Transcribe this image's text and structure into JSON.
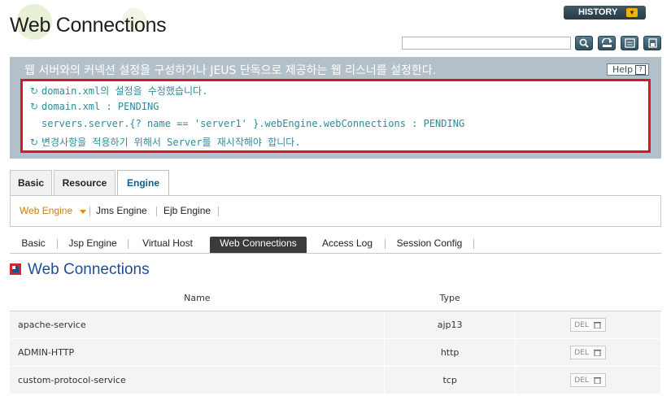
{
  "header": {
    "title": "Web Connections",
    "history_label": "HISTORY",
    "search_value": ""
  },
  "message": {
    "title": "웹 서버와의 커넥션 설정을 구성하거나 JEUS 단독으로 제공하는 웹 리스너를 설정한다.",
    "help_label": "Help",
    "lines": [
      "domain.xml의 설정을 수정했습니다.",
      "domain.xml : PENDING",
      "servers.server.{? name == 'server1' }.webEngine.webConnections : PENDING",
      "변경사항을 적용하기 위해서 Server를 재시작해야 합니다."
    ]
  },
  "tabs": [
    "Basic",
    "Resource",
    "Engine"
  ],
  "active_tab": "Engine",
  "subnav": [
    "Web Engine",
    "Jms Engine",
    "Ejb Engine"
  ],
  "active_subnav": "Web Engine",
  "subtabs": [
    "Basic",
    "Jsp Engine",
    "Virtual Host",
    "Web Connections",
    "Access Log",
    "Session Config"
  ],
  "active_subtab": "Web Connections",
  "section": {
    "title": "Web Connections"
  },
  "table": {
    "headers": [
      "Name",
      "Type",
      ""
    ],
    "rows": [
      {
        "name": "apache-service",
        "type": "ajp13",
        "action": "DEL"
      },
      {
        "name": "ADMIN-HTTP",
        "type": "http",
        "action": "DEL"
      },
      {
        "name": "custom-protocol-service",
        "type": "tcp",
        "action": "DEL"
      }
    ]
  },
  "colors": {
    "accent": "#1e4f96",
    "highlight_border": "#e0141e",
    "active_subnav": "#d67c00"
  }
}
